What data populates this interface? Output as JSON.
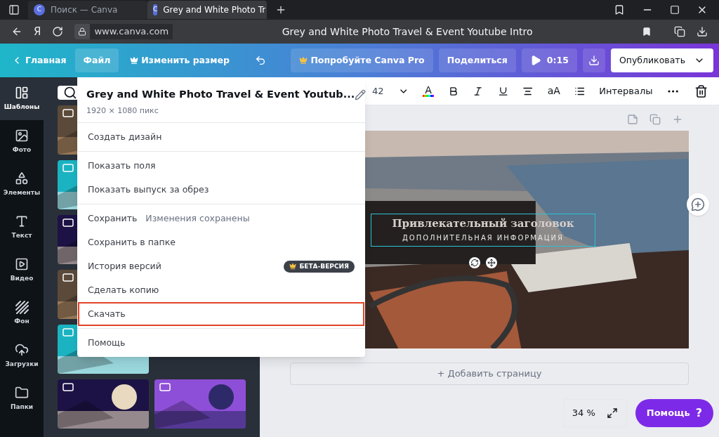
{
  "browser": {
    "tabs": [
      {
        "title": "Поиск — Canva",
        "icon_letter": "C",
        "selected": false
      },
      {
        "title": "Grey and White Photo Tr",
        "icon_letter": "C",
        "selected": true
      }
    ],
    "logo": "Я",
    "url": "www.canva.com",
    "page_title": "Grey and White Photo Travel & Event Youtube Intro"
  },
  "header": {
    "home": "Главная",
    "file": "Файл",
    "resize": "Изменить размер",
    "pro": "Попробуйте Canva Pro",
    "share": "Поделиться",
    "duration": "0:15",
    "publish": "Опубликовать"
  },
  "rail": [
    {
      "label": "Шаблоны",
      "selected": true
    },
    {
      "label": "Фото",
      "selected": false
    },
    {
      "label": "Элементы",
      "selected": false
    },
    {
      "label": "Текст",
      "selected": false
    },
    {
      "label": "Видео",
      "selected": false
    },
    {
      "label": "Фон",
      "selected": false
    },
    {
      "label": "Загрузки",
      "selected": false
    },
    {
      "label": "Папки",
      "selected": false
    }
  ],
  "toolbar": {
    "font_size": "42",
    "text_color": "A",
    "letter_case": "aA",
    "spacing": "Интервалы"
  },
  "menu": {
    "title": "Grey and White Photo Travel & Event Youtub...",
    "subtitle": "1920 × 1080 пикс",
    "sections": [
      [
        {
          "label": "Создать дизайн",
          "selected": false
        }
      ],
      [
        {
          "label": "Показать поля",
          "selected": false
        },
        {
          "label": "Показать выпуск за обрез",
          "selected": false
        }
      ],
      [
        {
          "label": "Сохранить",
          "note": "Изменения сохранены",
          "selected": false
        },
        {
          "label": "Сохранить в папке",
          "selected": false
        },
        {
          "label": "История версий",
          "badge": "БЕТА-ВЕРСИЯ",
          "selected": false
        },
        {
          "label": "Сделать копию",
          "selected": false
        },
        {
          "label": "Скачать",
          "selected": true
        }
      ],
      [
        {
          "label": "Помощь",
          "selected": false
        }
      ]
    ]
  },
  "design": {
    "headline": "Привлекательный заголовок",
    "subline": "ДОПОЛНИТЕЛЬНАЯ ИНФОРМАЦИЯ"
  },
  "add_page": "+ Добавить страницу",
  "zoom": "34 %",
  "help": "Помощь",
  "help_mark": "?"
}
